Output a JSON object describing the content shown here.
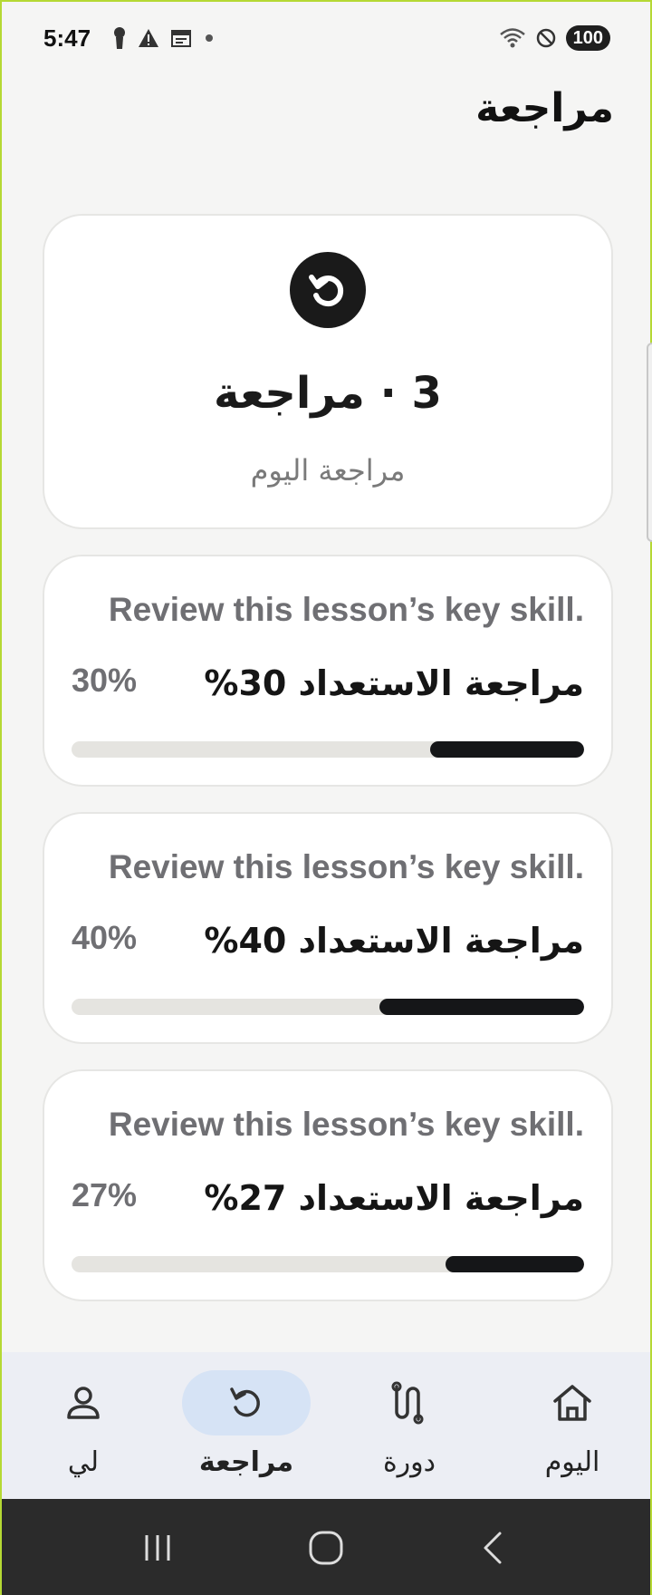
{
  "status_bar": {
    "time": "5:47",
    "battery": "100",
    "icons": [
      "keyhole-icon",
      "warning-icon",
      "calendar-icon",
      "dot-icon",
      "wifi-icon",
      "do-not-disturb-icon"
    ]
  },
  "header": {
    "title": "مراجعة"
  },
  "summary": {
    "title": "3 · مراجعة",
    "subtitle": "مراجعة اليوم",
    "icon": "refresh-icon"
  },
  "skills": [
    {
      "description": "Review this lesson’s key skill.",
      "label": "مراجعة الاستعداد 30%",
      "percent_text": "30%",
      "progress": 0.3
    },
    {
      "description": "Review this lesson’s key skill.",
      "label": "مراجعة الاستعداد 40%",
      "percent_text": "40%",
      "progress": 0.4
    },
    {
      "description": "Review this lesson’s key skill.",
      "label": "مراجعة الاستعداد 27%",
      "percent_text": "27%",
      "progress": 0.27
    }
  ],
  "bottom_nav": {
    "items": [
      {
        "label": "لي",
        "icon": "profile-icon",
        "active": false
      },
      {
        "label": "مراجعة",
        "icon": "refresh-icon",
        "active": true
      },
      {
        "label": "دورة",
        "icon": "route-icon",
        "active": false
      },
      {
        "label": "اليوم",
        "icon": "home-icon",
        "active": false
      }
    ]
  },
  "colors": {
    "background": "#f5f5f4",
    "card": "#ffffff",
    "progress_fill": "#151618",
    "progress_track": "#e5e4e0",
    "nav_background": "#eceef4",
    "nav_active_pill": "#d6e3f5"
  }
}
